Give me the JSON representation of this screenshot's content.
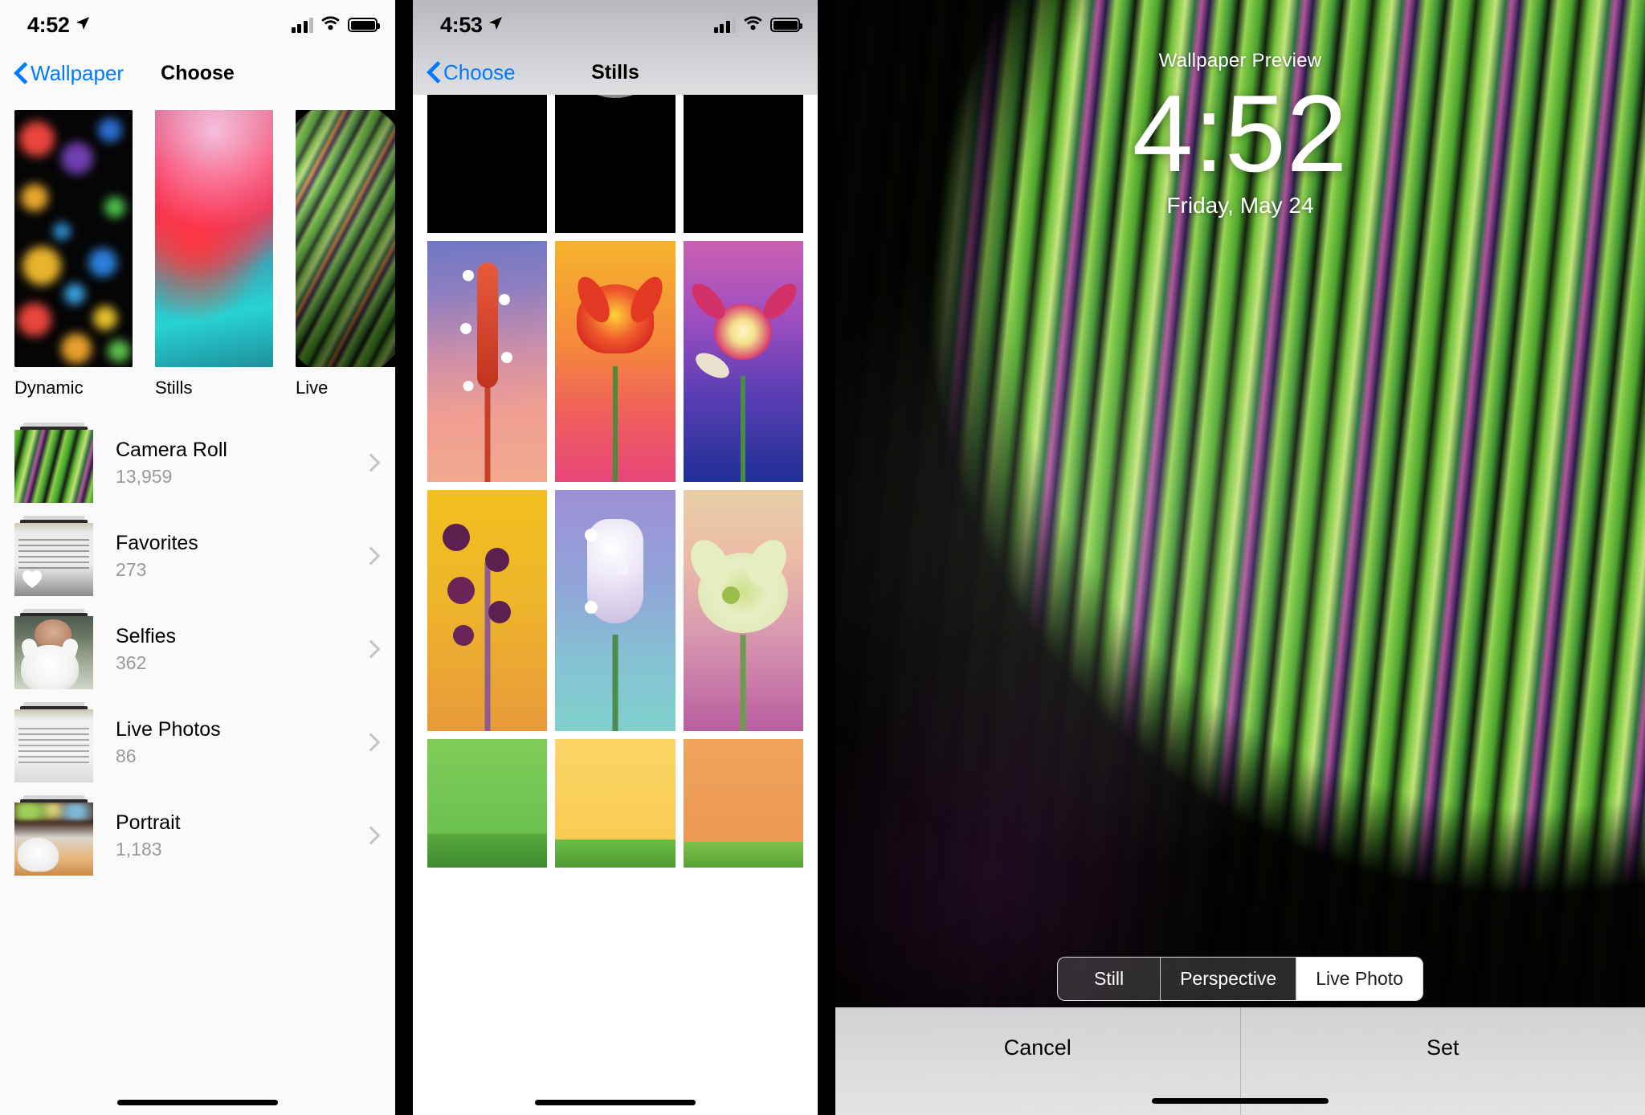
{
  "panel1": {
    "status": {
      "time": "4:52",
      "location_icon": "location-arrow-icon",
      "signal_icon": "cellular-bars-icon",
      "wifi_icon": "wifi-icon",
      "battery_icon": "battery-full-icon"
    },
    "nav": {
      "back_label": "Wallpaper",
      "title": "Choose",
      "back_icon": "chevron-left-icon"
    },
    "categories": [
      {
        "label": "Dynamic",
        "thumb": "bokeh-dots"
      },
      {
        "label": "Stills",
        "thumb": "pink-teal-gradient"
      },
      {
        "label": "Live",
        "thumb": "green-bubble"
      }
    ],
    "albums": [
      {
        "name": "Camera Roll",
        "count": "13,959",
        "thumb": "bubble-wallpaper"
      },
      {
        "name": "Favorites",
        "count": "273",
        "thumb": "document-scan",
        "badge_icon": "heart-icon"
      },
      {
        "name": "Selfies",
        "count": "362",
        "thumb": "selfie-with-cat"
      },
      {
        "name": "Live Photos",
        "count": "86",
        "thumb": "document-scan-2"
      },
      {
        "name": "Portrait",
        "count": "1,183",
        "thumb": "cat-portrait"
      }
    ],
    "disclosure_icon": "chevron-right-icon",
    "home_indicator": "home-indicator"
  },
  "panel2": {
    "status": {
      "time": "4:53",
      "location_icon": "location-arrow-icon",
      "signal_icon": "cellular-bars-icon",
      "wifi_icon": "wifi-icon",
      "battery_icon": "battery-full-icon"
    },
    "nav": {
      "back_label": "Choose",
      "title": "Stills",
      "back_icon": "chevron-left-icon"
    },
    "tiles": [
      {
        "name": "earth-day",
        "kind": "earth",
        "row": 0
      },
      {
        "name": "moon",
        "kind": "moon",
        "row": 0
      },
      {
        "name": "earth-night",
        "kind": "earth2",
        "row": 0
      },
      {
        "name": "red-bromeliad-flower",
        "kind": "flower1",
        "row": 1
      },
      {
        "name": "orange-gloriosa-lily",
        "kind": "flower2",
        "row": 1
      },
      {
        "name": "pink-columbine-flower",
        "kind": "flower3",
        "row": 1
      },
      {
        "name": "purple-fritillaria",
        "kind": "flower4",
        "row": 2
      },
      {
        "name": "white-grape-hyacinth",
        "kind": "flower5",
        "row": 2
      },
      {
        "name": "pale-hellebore",
        "kind": "flower6",
        "row": 2
      },
      {
        "name": "green-abstract",
        "kind": "green1",
        "row": 3
      },
      {
        "name": "yellow-abstract",
        "kind": "green2",
        "row": 3
      },
      {
        "name": "orange-abstract",
        "kind": "green3",
        "row": 3
      }
    ],
    "home_indicator": "home-indicator"
  },
  "panel3": {
    "preview_label": "Wallpaper Preview",
    "clock": "4:52",
    "date": "Friday, May 24",
    "segments": [
      {
        "label": "Still",
        "selected": false
      },
      {
        "label": "Perspective",
        "selected": false
      },
      {
        "label": "Live Photo",
        "selected": true
      }
    ],
    "cancel_label": "Cancel",
    "set_label": "Set",
    "home_indicator": "home-indicator"
  },
  "colors": {
    "accent_blue": "#007aff",
    "secondary_text": "#9a9a9e",
    "chevron_gray": "#c4c4c6",
    "panel_bg": "#fafafa"
  }
}
